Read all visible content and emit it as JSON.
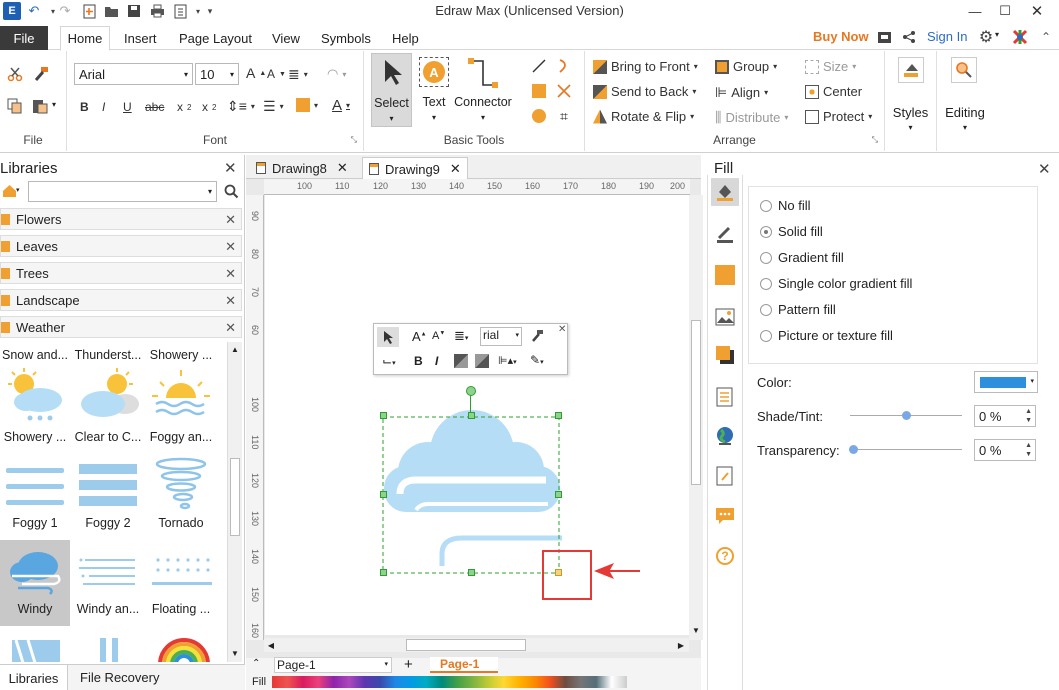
{
  "app": {
    "title": "Edraw Max (Unlicensed Version)"
  },
  "quick_access": [
    "app-logo-icon",
    "undo-icon",
    "redo-icon",
    "new-icon",
    "open-icon",
    "save-icon",
    "print-icon",
    "export-icon",
    "customize-icon"
  ],
  "menu": {
    "file": "File",
    "tabs": [
      "Home",
      "Insert",
      "Page Layout",
      "View",
      "Symbols",
      "Help"
    ],
    "buy_now": "Buy Now",
    "sign_in": "Sign In"
  },
  "ribbon": {
    "file_group": "File",
    "font_group": "Font",
    "font_name": "Arial",
    "font_size": "10",
    "basic_tools_group": "Basic Tools",
    "select": "Select",
    "text": "Text",
    "connector": "Connector",
    "arrange_group": "Arrange",
    "bring_to_front": "Bring to Front",
    "send_to_back": "Send to Back",
    "rotate_flip": "Rotate & Flip",
    "group": "Group",
    "align": "Align",
    "distribute": "Distribute",
    "size": "Size",
    "center": "Center",
    "protect": "Protect",
    "styles": "Styles",
    "editing": "Editing"
  },
  "libraries": {
    "title": "Libraries",
    "search_placeholder": "",
    "categories": [
      "Flowers",
      "Leaves",
      "Trees",
      "Landscape",
      "Weather"
    ],
    "shapes_row0": [
      "Snow and...",
      "Thunderst...",
      "Showery ..."
    ],
    "shapes_row1": [
      "Showery ...",
      "Clear to C...",
      "Foggy an..."
    ],
    "shapes_row2": [
      "Foggy 1",
      "Foggy 2",
      "Tornado"
    ],
    "shapes_row3": [
      "Windy",
      "Windy an...",
      "Floating ..."
    ],
    "bottom_tabs": [
      "Libraries",
      "File Recovery"
    ]
  },
  "documents": {
    "tabs": [
      "Drawing8",
      "Drawing9"
    ],
    "ruler_h": [
      "100",
      "110",
      "120",
      "130",
      "140",
      "150",
      "160",
      "170",
      "180",
      "190",
      "200"
    ],
    "ruler_v": [
      "90",
      "80",
      "70",
      "60",
      "100",
      "110",
      "120",
      "130",
      "140",
      "150",
      "160"
    ],
    "mini_toolbar_font": "rial"
  },
  "page_bar": {
    "page_select": "Page-1",
    "active_page": "Page-1",
    "fill_label": "Fill"
  },
  "fill_panel": {
    "title": "Fill",
    "options": [
      "No fill",
      "Solid fill",
      "Gradient fill",
      "Single color gradient fill",
      "Pattern fill",
      "Picture or texture fill"
    ],
    "selected": "Solid fill",
    "color_label": "Color:",
    "color_value": "#2e8fdc",
    "shade_label": "Shade/Tint:",
    "shade_value": "0 %",
    "transparency_label": "Transparency:",
    "transparency_value": "0 %"
  },
  "colors": {
    "accent": "#2b6cc4",
    "buy_now": "#e87722",
    "cloud": "#b6ddf6",
    "selection": "#2ca02c",
    "highlight": "#e53935"
  }
}
